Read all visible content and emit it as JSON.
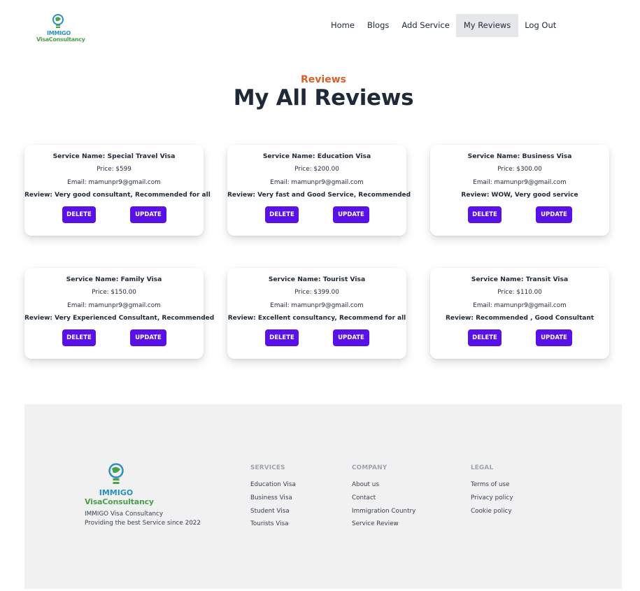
{
  "header": {
    "logo": {
      "line1": "IMMIGO",
      "line2": "VisaConsultancy"
    },
    "nav": [
      {
        "label": "Home"
      },
      {
        "label": "Blogs"
      },
      {
        "label": "Add Service"
      },
      {
        "label": "My Reviews",
        "active": true
      },
      {
        "label": "Log Out"
      }
    ]
  },
  "heading": {
    "eyebrow": "Reviews",
    "title": "My All Reviews"
  },
  "reviews": [
    {
      "service": "Service Name: Special Travel Visa",
      "price": "Price: $599",
      "email": "Email: mamunpr9@gmail.com",
      "review": "Review: Very good consultant, Recommended for all"
    },
    {
      "service": "Service Name: Education Visa",
      "price": "Price: $200.00",
      "email": "Email: mamunpr9@gmail.com",
      "review": "Review: Very fast and Good Service, Recommended"
    },
    {
      "service": "Service Name: Business Visa",
      "price": "Price: $300.00",
      "email": "Email: mamunpr9@gmail.com",
      "review": "Review: WOW, Very good service"
    },
    {
      "service": "Service Name: Family Visa",
      "price": "Price: $150.00",
      "email": "Email: mamunpr9@gmail.com",
      "review": "Review: Very Experienced Consultant, Recommended"
    },
    {
      "service": "Service Name: Tourist Visa",
      "price": "Price: $399.00",
      "email": "Email: mamunpr9@gmail.com",
      "review": "Review: Excellent consultancy, Recommend for all"
    },
    {
      "service": "Service Name: Transit Visa",
      "price": "Price: $110.00",
      "email": "Email: mamunpr9@gmail.com",
      "review": "Review: Recommended , Good Consultant"
    }
  ],
  "buttons": {
    "delete": "DELETE",
    "update": "UPDATE"
  },
  "footer": {
    "logo": {
      "line1": "IMMIGO",
      "line2": "VisaConsultancy"
    },
    "tagline1": "IMMIGO Visa Consultancy",
    "tagline2": "Providing the best Service since 2022",
    "columns": [
      {
        "heading": "SERVICES",
        "links": [
          "Education Visa",
          "Business Visa",
          "Student Visa",
          "Tourists Visa"
        ]
      },
      {
        "heading": "COMPANY",
        "links": [
          "About us",
          "Contact",
          "Immigration Country",
          "Service Review"
        ]
      },
      {
        "heading": "LEGAL",
        "links": [
          "Terms of use",
          "Privacy policy",
          "Cookie policy"
        ]
      }
    ]
  },
  "colors": {
    "accent": "#5a11e8",
    "eyebrow": "#d9602a",
    "logo_blue": "#2a8fc5",
    "logo_green": "#4ba04b",
    "footer_bg": "#f1f1f1"
  }
}
